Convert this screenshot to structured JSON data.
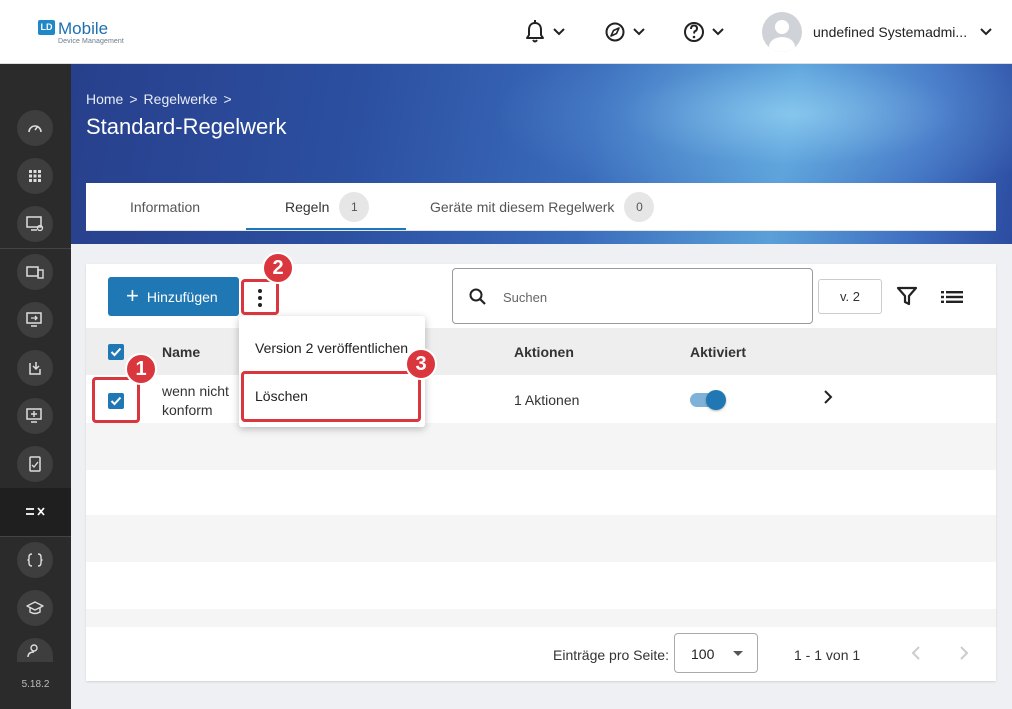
{
  "app": {
    "logo_badge": "LD",
    "logo_main": "Mobile",
    "logo_sub": "Device Management",
    "version": "5.18.2"
  },
  "header": {
    "user_name": "undefined Systemadmi..."
  },
  "breadcrumb": [
    "Home",
    "Regelwerke"
  ],
  "page_title": "Standard-Regelwerk",
  "tabs": [
    {
      "label": "Information",
      "badge": ""
    },
    {
      "label": "Regeln",
      "badge": "1"
    },
    {
      "label": "Geräte mit diesem Regelwerk",
      "badge": "0"
    }
  ],
  "toolbar": {
    "add_label": "Hinzufügen",
    "search_placeholder": "Suchen",
    "version_value": "v. 2"
  },
  "menu": {
    "items": [
      "Version 2 veröffentlichen",
      "Löschen"
    ]
  },
  "table": {
    "columns": [
      "Name",
      "Aktionen",
      "Aktiviert"
    ],
    "rows": [
      {
        "name": "wenn nicht konform",
        "name_line1": "wenn nicht",
        "name_line2": "konform",
        "actions": "1 Aktionen",
        "enabled": true,
        "selected": true
      }
    ]
  },
  "pagination": {
    "per_page_label": "Einträge pro Seite:",
    "per_page_value": "100",
    "range": "1 - 1 von 1"
  },
  "annotations": [
    "1",
    "2",
    "3"
  ],
  "colors": {
    "primary": "#1f78b4",
    "annotation": "#d9363e",
    "sidebar": "#2b2b2b"
  }
}
